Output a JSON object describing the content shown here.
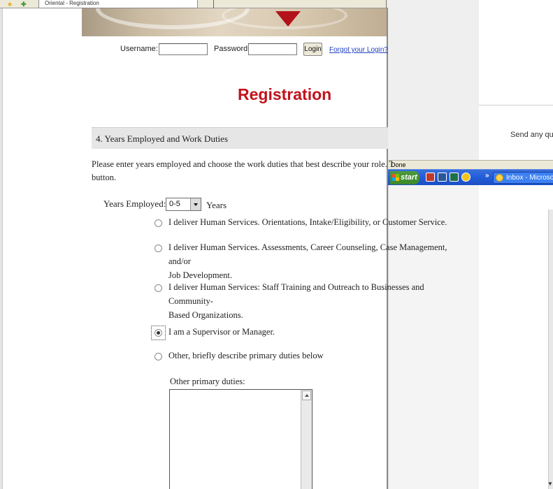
{
  "topbar": {
    "tab_title": "Oriental - Registration",
    "status_text": "Done"
  },
  "login": {
    "username_label": "Username:",
    "username_value": "",
    "password_label": "Password:",
    "password_value": "",
    "login_button": "Login",
    "forgot_link": "Forgot your Login?"
  },
  "page": {
    "title": "Registration",
    "section_header": "4. Years Employed and Work Duties",
    "instructions_line1": "Please enter years employed and choose the work duties that best describe your role. Then",
    "instructions_line2": "button."
  },
  "years": {
    "label": "Years Employed:",
    "selected": "0-5",
    "unit": "Years"
  },
  "duties": {
    "options": [
      {
        "label": "I deliver Human Services. Orientations, Intake/Eligibility, or Customer Service.",
        "checked": false
      },
      {
        "label": "I deliver Human Services. Assessments, Career Counseling, Case Management, and/or",
        "label_cont": "Job Development.",
        "checked": false
      },
      {
        "label": "I deliver Human Services: Staff Training and Outreach to Businesses and Community-",
        "label_cont": "Based Organizations.",
        "checked": false
      },
      {
        "label": "I am a Supervisor or Manager.",
        "checked": true
      },
      {
        "label": "Other, briefly describe primary duties below",
        "checked": false
      }
    ],
    "other_label": "Other primary duties:",
    "other_value": ""
  },
  "background_window": {
    "send_text": "Send any que"
  },
  "taskbar": {
    "start_label": "start",
    "overflow": "»",
    "task_label": "Inbox - Microsoft"
  },
  "colors": {
    "title_red": "#c2121c",
    "link_blue": "#1f3fbf",
    "section_gray": "#e6e6e6",
    "taskbar_blue": "#245edb",
    "start_green": "#3c8a2c"
  }
}
